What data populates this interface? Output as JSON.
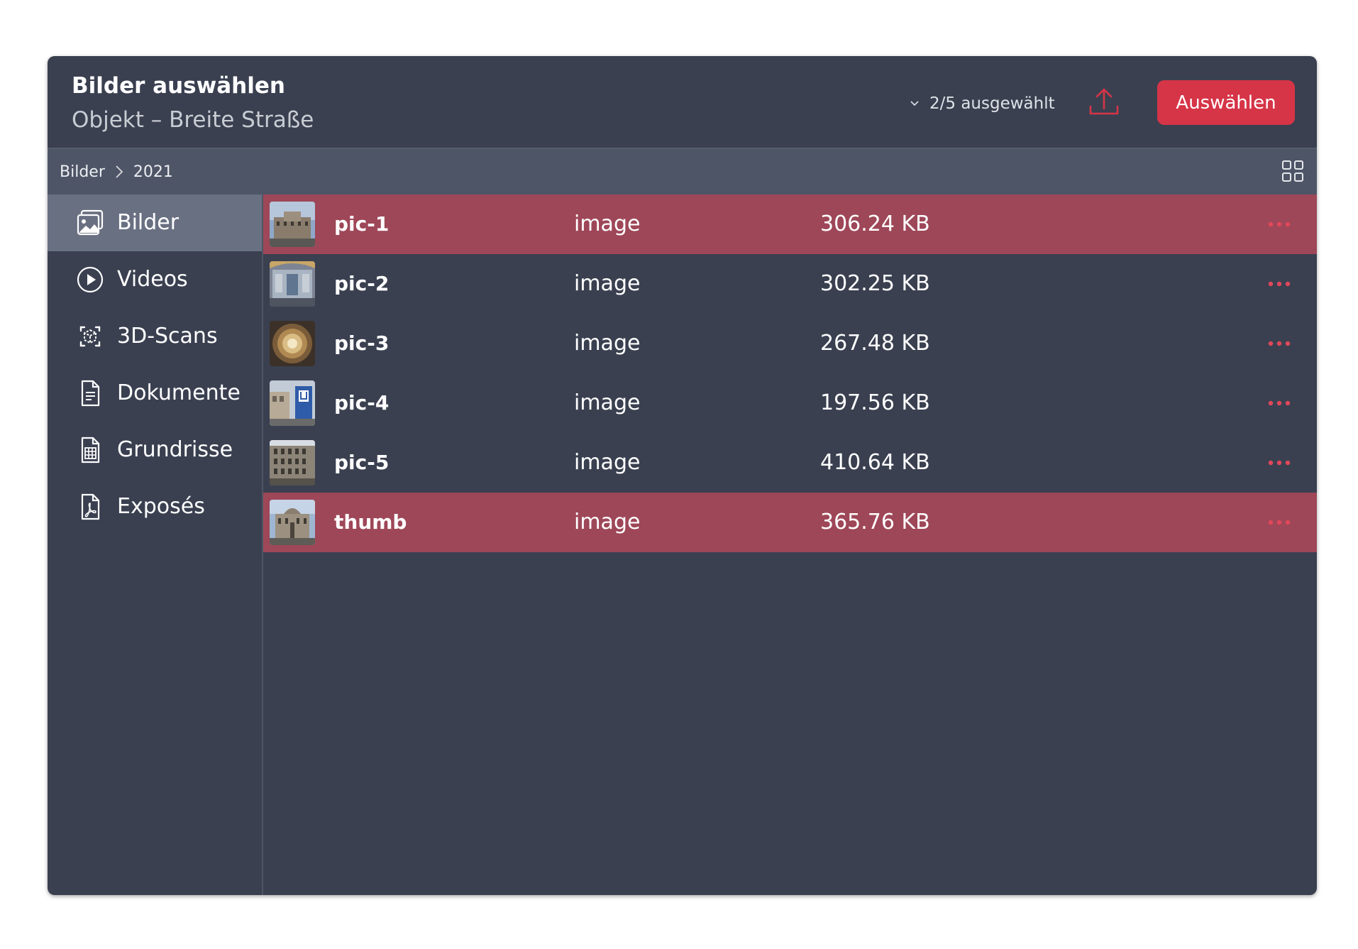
{
  "colors": {
    "accent": "#d63447",
    "selected_row": "#9e4758",
    "panel": "#3a4050",
    "toolbar": "#4e5566",
    "active_nav": "#697082"
  },
  "header": {
    "title": "Bilder auswählen",
    "subtitle": "Objekt – Breite Straße",
    "selection_count": "2/5 ausgewählt",
    "select_button": "Auswählen",
    "upload_icon": "upload-icon"
  },
  "breadcrumb": {
    "items": [
      "Bilder",
      "2021"
    ],
    "separator_icon": "chevron-right-icon"
  },
  "view_toggle_icon": "grid-view-icon",
  "sidebar": {
    "items": [
      {
        "label": "Bilder",
        "icon": "images-icon",
        "active": true
      },
      {
        "label": "Videos",
        "icon": "play-circle-icon",
        "active": false
      },
      {
        "label": "3D-Scans",
        "icon": "3d-scan-icon",
        "active": false
      },
      {
        "label": "Dokumente",
        "icon": "document-icon",
        "active": false
      },
      {
        "label": "Grundrisse",
        "icon": "floorplan-icon",
        "active": false
      },
      {
        "label": "Exposés",
        "icon": "pdf-icon",
        "active": false
      }
    ]
  },
  "files": [
    {
      "name": "pic-1",
      "type": "image",
      "size": "306.24 KB",
      "selected": true
    },
    {
      "name": "pic-2",
      "type": "image",
      "size": "302.25 KB",
      "selected": false
    },
    {
      "name": "pic-3",
      "type": "image",
      "size": "267.48 KB",
      "selected": false
    },
    {
      "name": "pic-4",
      "type": "image",
      "size": "197.56 KB",
      "selected": false
    },
    {
      "name": "pic-5",
      "type": "image",
      "size": "410.64 KB",
      "selected": false
    },
    {
      "name": "thumb",
      "type": "image",
      "size": "365.76 KB",
      "selected": true
    }
  ]
}
